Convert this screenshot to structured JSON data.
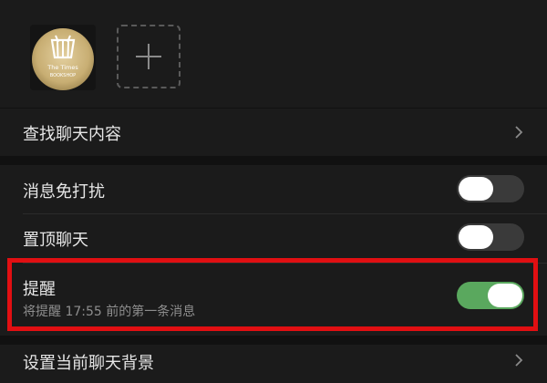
{
  "chat_info": {
    "member_avatar": {
      "logo_line1": "The Times",
      "logo_line2": "BOOKSHOP"
    },
    "add_member_icon": "plus-icon"
  },
  "settings": {
    "search_chat": {
      "label": "查找聊天内容",
      "icon": "chevron-right-icon"
    },
    "mute": {
      "label": "消息免打扰",
      "enabled": false
    },
    "sticky_on_top": {
      "label": "置顶聊天",
      "enabled": false
    },
    "reminder": {
      "label": "提醒",
      "description": "将提醒 17:55 前的第一条消息",
      "enabled": true
    },
    "chat_background": {
      "label": "设置当前聊天背景",
      "icon": "chevron-right-icon"
    }
  },
  "colors": {
    "toggle_on": "#5aa85e",
    "highlight": "#e10f12"
  }
}
